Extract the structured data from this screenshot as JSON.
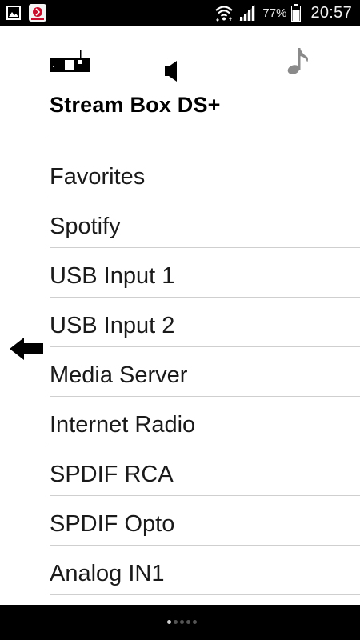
{
  "status_bar": {
    "icons_left": [
      "gallery-icon",
      "app-notification-icon"
    ],
    "icons_right": [
      "wifi-icon",
      "signal-icon",
      "battery-icon"
    ],
    "battery_percent": "77%",
    "time": "20:57"
  },
  "header": {
    "device_icon": "stream-box-device-icon",
    "volume_icon": "speaker-volume-icon",
    "music_icon": "music-note-icon",
    "title": "Stream Box DS+"
  },
  "back_arrow_icon": "back-arrow-icon",
  "sources": [
    {
      "label": "Favorites"
    },
    {
      "label": "Spotify"
    },
    {
      "label": "USB Input 1"
    },
    {
      "label": "USB Input 2"
    },
    {
      "label": "Media Server"
    },
    {
      "label": "Internet Radio"
    },
    {
      "label": "SPDIF RCA"
    },
    {
      "label": "SPDIF Opto"
    },
    {
      "label": "Analog IN1"
    }
  ],
  "page_indicator": {
    "pages": 5,
    "current": 1
  },
  "colors": {
    "status_bar_bg": "#000000",
    "background": "#ffffff",
    "text": "#1a1a1a",
    "divider": "#cfcfcf",
    "music_icon": "#8a8a8a"
  }
}
